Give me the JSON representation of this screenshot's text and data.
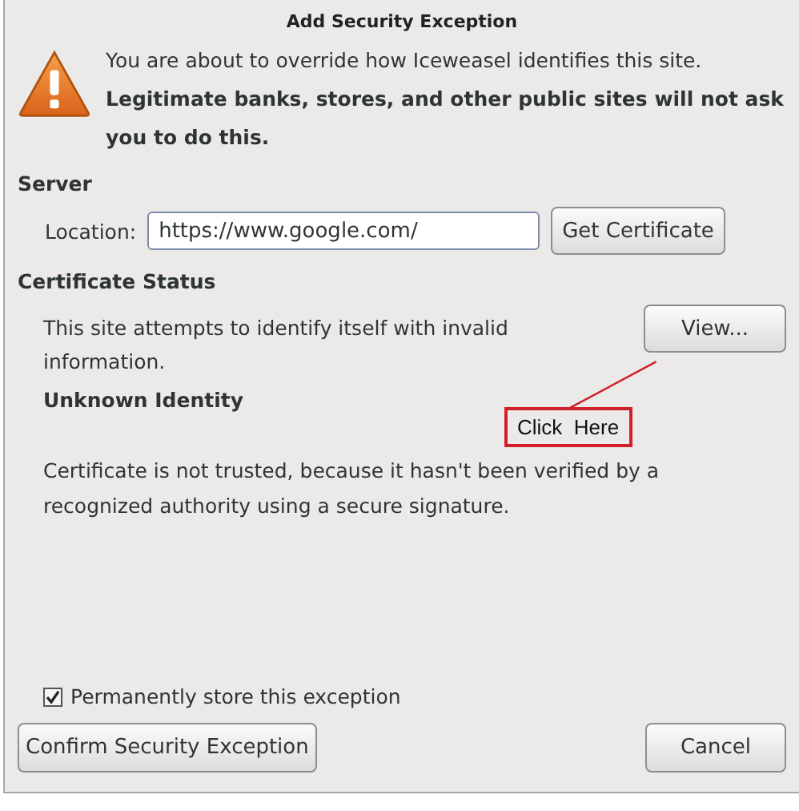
{
  "window": {
    "title": "Add Security Exception"
  },
  "warning": {
    "line": "You are about to override how Iceweasel identifies this site.",
    "bold_line": "Legitimate banks, stores, and other public sites will not ask you to do this."
  },
  "server": {
    "heading": "Server",
    "location_label": "Location:",
    "location_value": "https://www.google.com/",
    "button": "Get Certificate"
  },
  "certificate_status": {
    "heading": "Certificate Status",
    "description": "This site attempts to identify itself with invalid information.",
    "view_button": "View...",
    "issue_title": "Unknown Identity",
    "issue_text": "Certificate is not trusted, because it hasn't been verified by a recognized authority using a secure signature."
  },
  "annotation": {
    "text": "Click  Here"
  },
  "permanent": {
    "label": "Permanently store this exception",
    "checked": true
  },
  "buttons": [
    {
      "label": "Confirm Security Exception",
      "kind": "confirm"
    },
    {
      "label": "Cancel",
      "kind": "cancel"
    }
  ]
}
